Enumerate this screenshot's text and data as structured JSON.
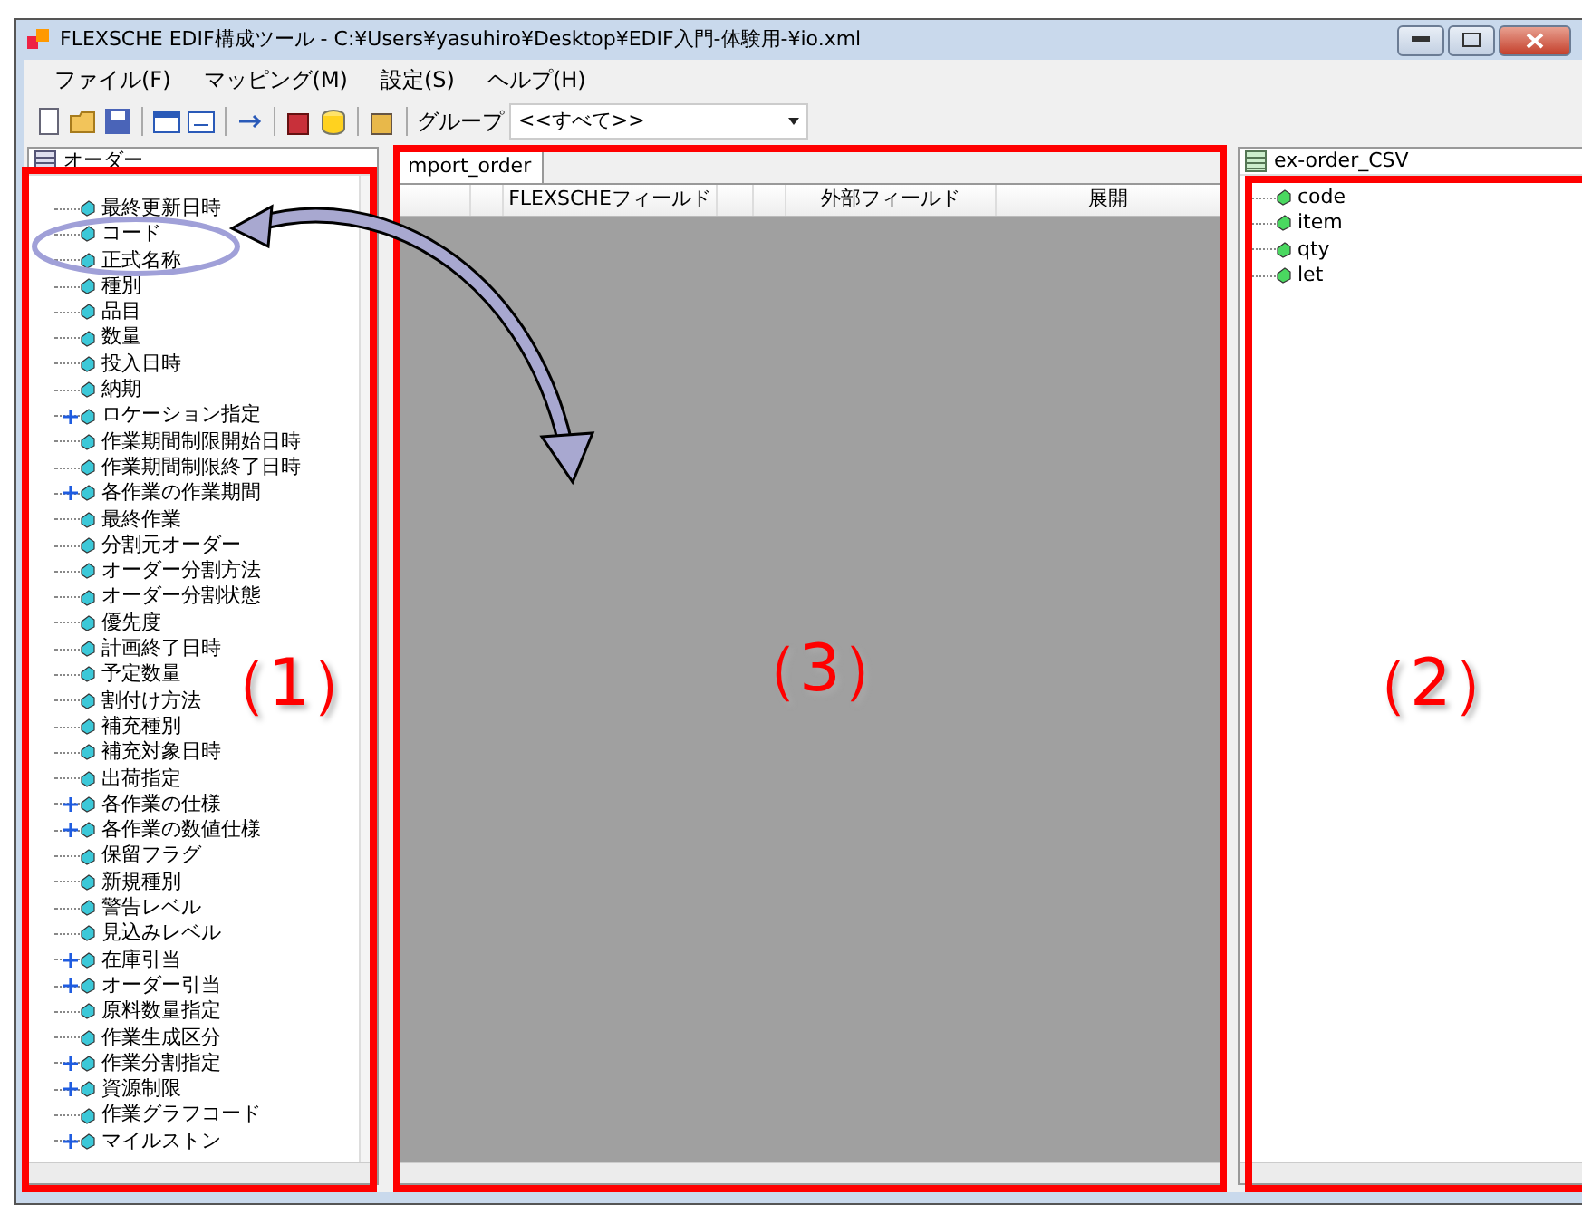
{
  "window": {
    "title": "FLEXSCHE EDIF構成ツール - C:¥Users¥yasuhiro¥Desktop¥EDIF入門-体験用-¥io.xml"
  },
  "menu": [
    {
      "label": "ファイル(F)"
    },
    {
      "label": "マッピング(M)"
    },
    {
      "label": "設定(S)"
    },
    {
      "label": "ヘルプ(H)"
    }
  ],
  "toolbar": {
    "group_label": "グループ",
    "group_value": "<<すべて>>"
  },
  "left_panel": {
    "title": "オーダー",
    "items": [
      {
        "label": "最終更新日時",
        "kind": "leaf"
      },
      {
        "label": "コード",
        "kind": "leaf"
      },
      {
        "label": "正式名称",
        "kind": "leaf"
      },
      {
        "label": "種別",
        "kind": "leaf"
      },
      {
        "label": "品目",
        "kind": "leaf"
      },
      {
        "label": "数量",
        "kind": "leaf"
      },
      {
        "label": "投入日時",
        "kind": "leaf"
      },
      {
        "label": "納期",
        "kind": "leaf"
      },
      {
        "label": "ロケーション指定",
        "kind": "group"
      },
      {
        "label": "作業期間制限開始日時",
        "kind": "leaf"
      },
      {
        "label": "作業期間制限終了日時",
        "kind": "leaf"
      },
      {
        "label": "各作業の作業期間",
        "kind": "group"
      },
      {
        "label": "最終作業",
        "kind": "leaf"
      },
      {
        "label": "分割元オーダー",
        "kind": "leaf"
      },
      {
        "label": "オーダー分割方法",
        "kind": "leaf"
      },
      {
        "label": "オーダー分割状態",
        "kind": "leaf"
      },
      {
        "label": "優先度",
        "kind": "leaf"
      },
      {
        "label": "計画終了日時",
        "kind": "leaf"
      },
      {
        "label": "予定数量",
        "kind": "leaf"
      },
      {
        "label": "割付け方法",
        "kind": "leaf"
      },
      {
        "label": "補充種別",
        "kind": "leaf"
      },
      {
        "label": "補充対象日時",
        "kind": "leaf"
      },
      {
        "label": "出荷指定",
        "kind": "leaf"
      },
      {
        "label": "各作業の仕様",
        "kind": "group"
      },
      {
        "label": "各作業の数値仕様",
        "kind": "group"
      },
      {
        "label": "保留フラグ",
        "kind": "leaf"
      },
      {
        "label": "新規種別",
        "kind": "leaf"
      },
      {
        "label": "警告レベル",
        "kind": "leaf"
      },
      {
        "label": "見込みレベル",
        "kind": "leaf"
      },
      {
        "label": "在庫引当",
        "kind": "group"
      },
      {
        "label": "オーダー引当",
        "kind": "group"
      },
      {
        "label": "原料数量指定",
        "kind": "leaf"
      },
      {
        "label": "作業生成区分",
        "kind": "leaf"
      },
      {
        "label": "作業分割指定",
        "kind": "group"
      },
      {
        "label": "資源制限",
        "kind": "group"
      },
      {
        "label": "作業グラフコード",
        "kind": "leaf"
      },
      {
        "label": "マイルストン",
        "kind": "group"
      }
    ]
  },
  "center_panel": {
    "tab": "mport_order",
    "columns": [
      "FLEXSCHEフィールド",
      "外部フィールド",
      "展開"
    ]
  },
  "right_panel": {
    "title": "ex-order_CSV",
    "items": [
      {
        "label": "code"
      },
      {
        "label": "item"
      },
      {
        "label": "qty"
      },
      {
        "label": "let"
      }
    ]
  },
  "annotations": [
    {
      "label": "（1）"
    },
    {
      "label": "（3）"
    },
    {
      "label": "（2）"
    }
  ]
}
